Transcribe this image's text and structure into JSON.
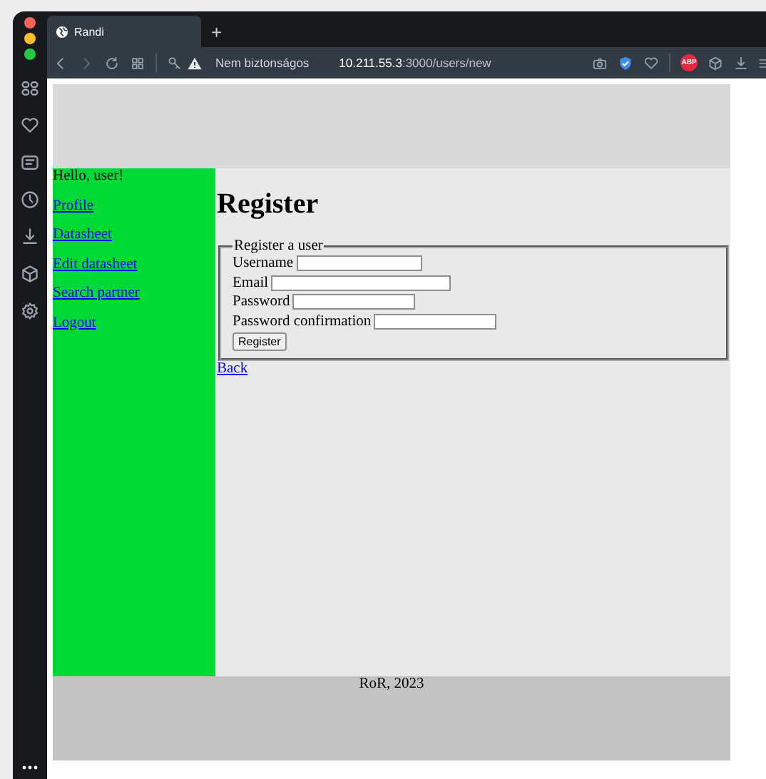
{
  "browser": {
    "tabs": [
      {
        "title": "Randi",
        "selected": true
      }
    ],
    "new_tab": "+",
    "security": "Nem biztonságos",
    "url_host": "10.211.55.3",
    "url_path": ":3000/users/new",
    "adblock": "ABP"
  },
  "page": {
    "greeting": "Hello, user!",
    "nav": [
      "Profile",
      "Datasheet",
      "Edit datasheet",
      "Search partner",
      "Logout"
    ],
    "heading": "Register",
    "legend": "Register a user",
    "fields": [
      {
        "label": "Username",
        "kind": "text"
      },
      {
        "label": "Email",
        "kind": "email"
      },
      {
        "label": "Password",
        "kind": "password"
      },
      {
        "label": "Password confirmation",
        "kind": "password"
      }
    ],
    "submit": "Register",
    "back": "Back",
    "footer": "RoR, 2023"
  }
}
